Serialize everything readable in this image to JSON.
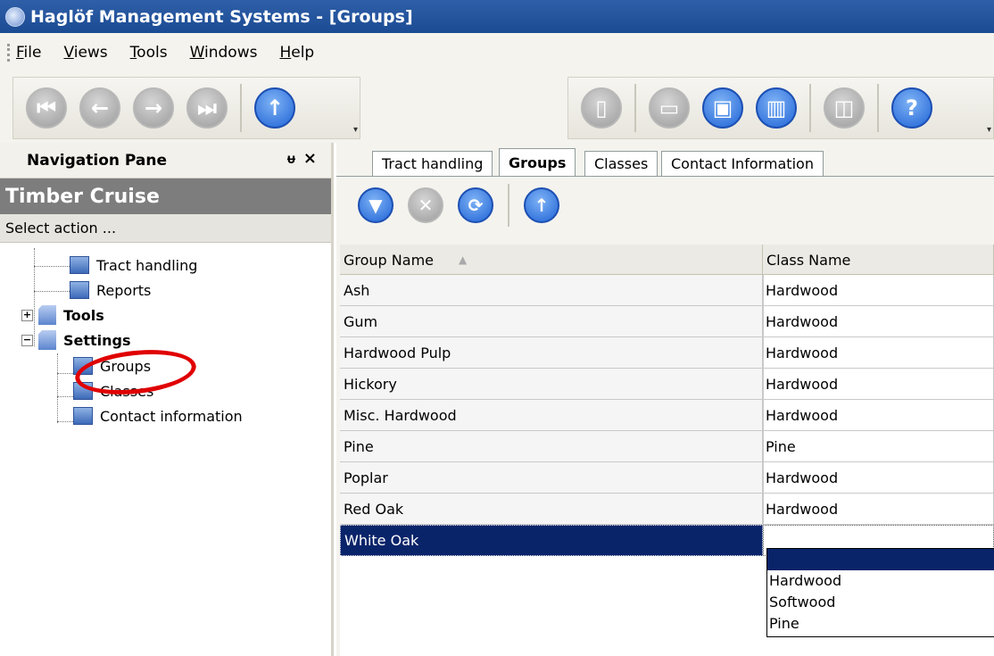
{
  "window": {
    "title": "Haglöf Management Systems - [Groups]"
  },
  "menu": [
    "File",
    "Views",
    "Tools",
    "Windows",
    "Help"
  ],
  "nav": {
    "header": "Navigation Pane",
    "pin_glyph": "ᵾ",
    "close_glyph": "×",
    "section_title": "Timber Cruise",
    "select_action": "Select action ...",
    "items": [
      {
        "label": "Tract handling"
      },
      {
        "label": "Reports"
      },
      {
        "label": "Tools"
      },
      {
        "label": "Settings"
      },
      {
        "label": "Groups"
      },
      {
        "label": "Classes"
      },
      {
        "label": "Contact information"
      }
    ]
  },
  "tabs": [
    "Tract handling",
    "Groups",
    "Classes",
    "Contact Information"
  ],
  "grid": {
    "columns": [
      "Group Name",
      "Class Name"
    ],
    "rows": [
      {
        "group": "Ash",
        "class": "Hardwood"
      },
      {
        "group": "Gum",
        "class": "Hardwood"
      },
      {
        "group": "Hardwood Pulp",
        "class": "Hardwood"
      },
      {
        "group": "Hickory",
        "class": "Hardwood"
      },
      {
        "group": "Misc. Hardwood",
        "class": "Hardwood"
      },
      {
        "group": "Pine",
        "class": "Pine"
      },
      {
        "group": "Poplar",
        "class": "Hardwood"
      },
      {
        "group": "Red Oak",
        "class": "Hardwood"
      },
      {
        "group": "White Oak",
        "class": ""
      }
    ],
    "dropdown_options": [
      "Hardwood",
      "Softwood",
      "Pine"
    ]
  },
  "colors": {
    "titlebar": "#2f5fa8",
    "selection": "#0a246a",
    "annotation": "#e00000"
  }
}
